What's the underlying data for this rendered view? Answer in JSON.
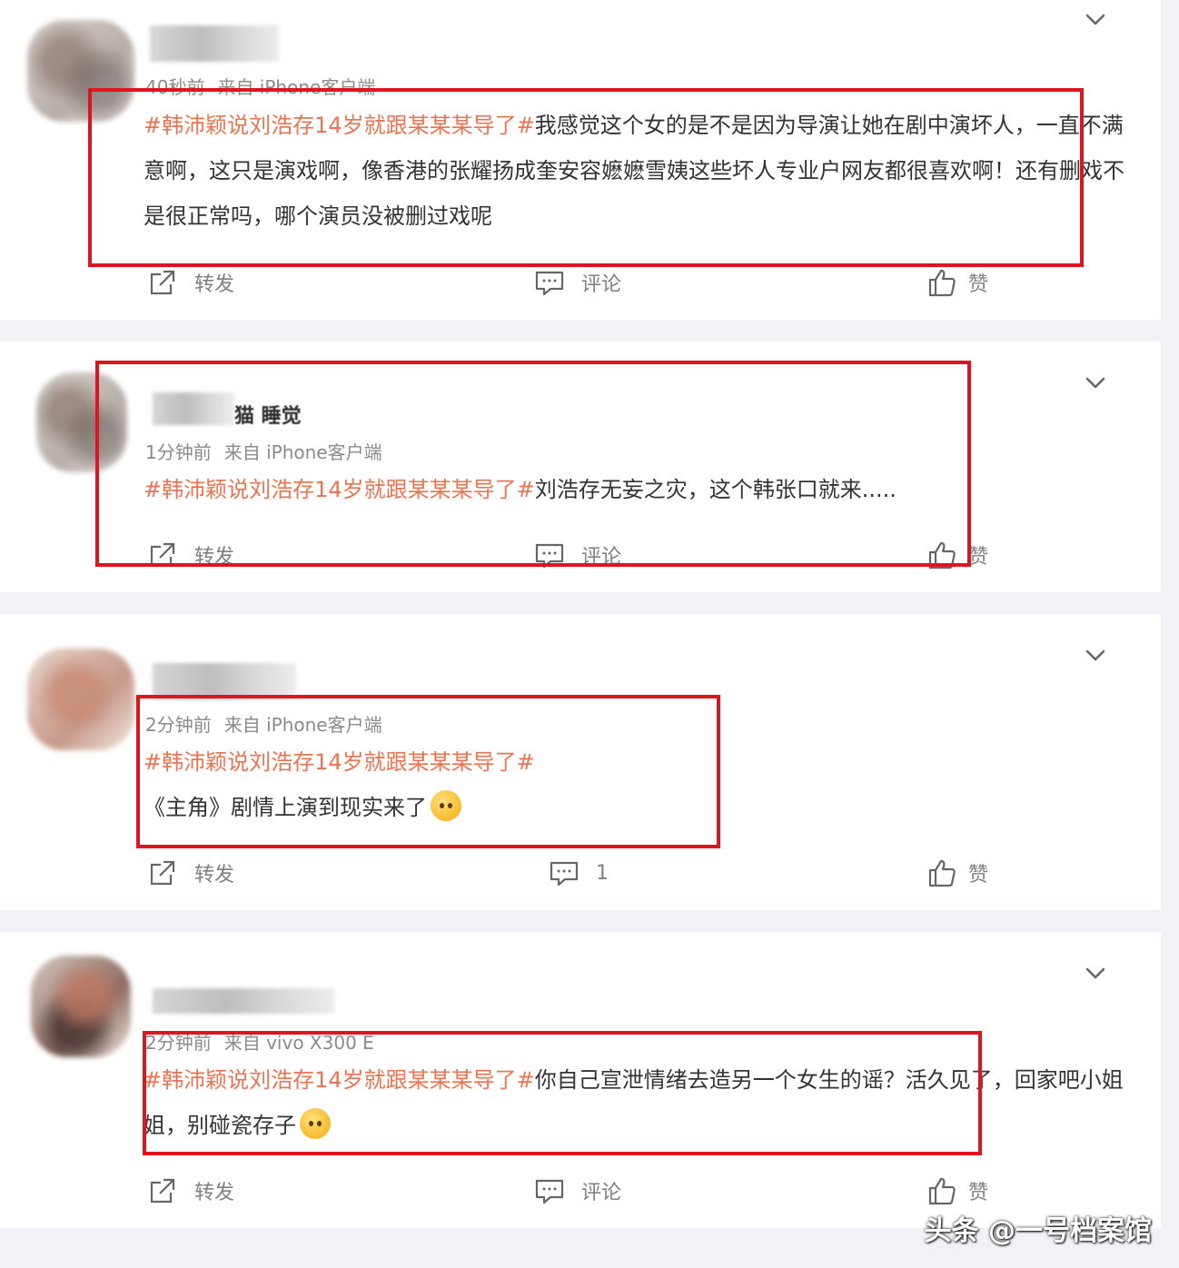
{
  "posts": [
    {
      "meta_time": "40秒前",
      "meta_source": "来自 iPhone客户端",
      "topic": "#韩沛颖说刘浩存14岁就跟某某某导了#",
      "text": "我感觉这个女的是不是因为导演让她在剧中演坏人，一直不满意啊，这只是演戏啊，像香港的张耀扬成奎安容嬷嬷雪姨这些坏人专业户网友都很喜欢啊！还有删戏不是很正常吗，哪个演员没被删过戏呢",
      "forward_label": "转发",
      "comment_label": "评论",
      "like_label": "赞"
    },
    {
      "name": "猫 睡觉",
      "meta_time": "1分钟前",
      "meta_source": "来自 iPhone客户端",
      "topic": "#韩沛颖说刘浩存14岁就跟某某某导了#",
      "text": "刘浩存无妄之灾，这个韩张口就来.....",
      "forward_label": "转发",
      "comment_label": "评论",
      "like_label": "赞"
    },
    {
      "meta_time": "2分钟前",
      "meta_source": "来自 iPhone客户端",
      "topic": "#韩沛颖说刘浩存14岁就跟某某某导了#",
      "text": "《主角》剧情上演到现实来了",
      "forward_label": "转发",
      "comment_label": "1",
      "like_label": "赞"
    },
    {
      "meta_time": "2分钟前",
      "meta_source": "来自 vivo X300 E",
      "topic": "#韩沛颖说刘浩存14岁就跟某某某导了#",
      "text": "你自己宣泄情绪去造另一个女生的谣？活久见了，回家吧小姐姐，别碰瓷存子",
      "forward_label": "转发",
      "comment_label": "评论",
      "like_label": "赞"
    }
  ],
  "watermark": "头条 @一号档案馆",
  "colors": {
    "topic": "#eb7350",
    "highlight_box": "#e0141e",
    "page_bg": "#f1f2f5"
  },
  "icons": {
    "expand": "chevron-down-icon",
    "forward": "share-icon",
    "comment": "comment-icon",
    "like": "thumbs-up-icon",
    "emoji": "emoji-icon"
  }
}
